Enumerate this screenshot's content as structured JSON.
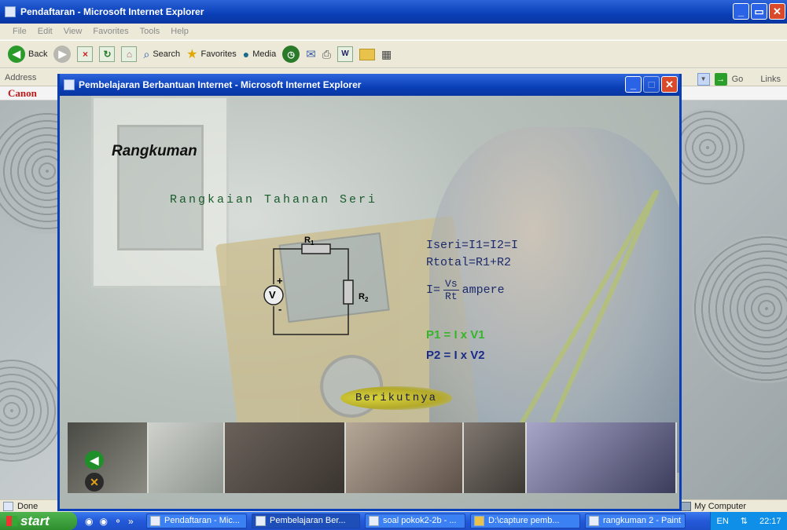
{
  "main_window": {
    "title": "Pendaftaran - Microsoft Internet Explorer",
    "menu": [
      "File",
      "Edit",
      "View",
      "Favorites",
      "Tools",
      "Help"
    ],
    "toolbar": {
      "back": "Back",
      "search": "Search",
      "favorites": "Favorites",
      "media": "Media"
    },
    "address_label": "Address",
    "go_label": "Go",
    "links_label": "Links",
    "brand": "Canon",
    "status_left": "Done",
    "status_right": "My Computer"
  },
  "popup": {
    "title": "Pembelajaran Berbantuan Internet - Microsoft Internet Explorer",
    "heading": "Rangkuman",
    "subheading": "Rangkaian Tahanan Seri",
    "circuit": {
      "r1": "R",
      "r1_sub": "1",
      "r2": "R",
      "r2_sub": "2",
      "meter": "V",
      "plus": "+",
      "minus": "-"
    },
    "formulas": {
      "line1": "Iseri=I1=I2=I",
      "line2": "Rtotal=R1+R2",
      "line3_prefix": "I=",
      "line3_num": "Vs",
      "line3_den": "Rt",
      "line3_suffix": "ampere",
      "p1": "P1 = I x V1",
      "p2": "P2 = I x V2"
    },
    "next_button": "Berikutnya",
    "colors": {
      "p1": "#35b52a",
      "p2": "#1c2a8a",
      "subheading": "#1a5b2c"
    }
  },
  "taskbar": {
    "start": "start",
    "tasks": [
      {
        "label": "Pendaftaran - Mic...",
        "active": false
      },
      {
        "label": "Pembelajaran Ber...",
        "active": true
      },
      {
        "label": "soal pokok2-2b - ...",
        "active": false
      },
      {
        "label": "D:\\capture pemb...",
        "active": false
      },
      {
        "label": "rangkuman 2 - Paint",
        "active": false
      }
    ],
    "lang": "EN",
    "time": "22:17"
  }
}
